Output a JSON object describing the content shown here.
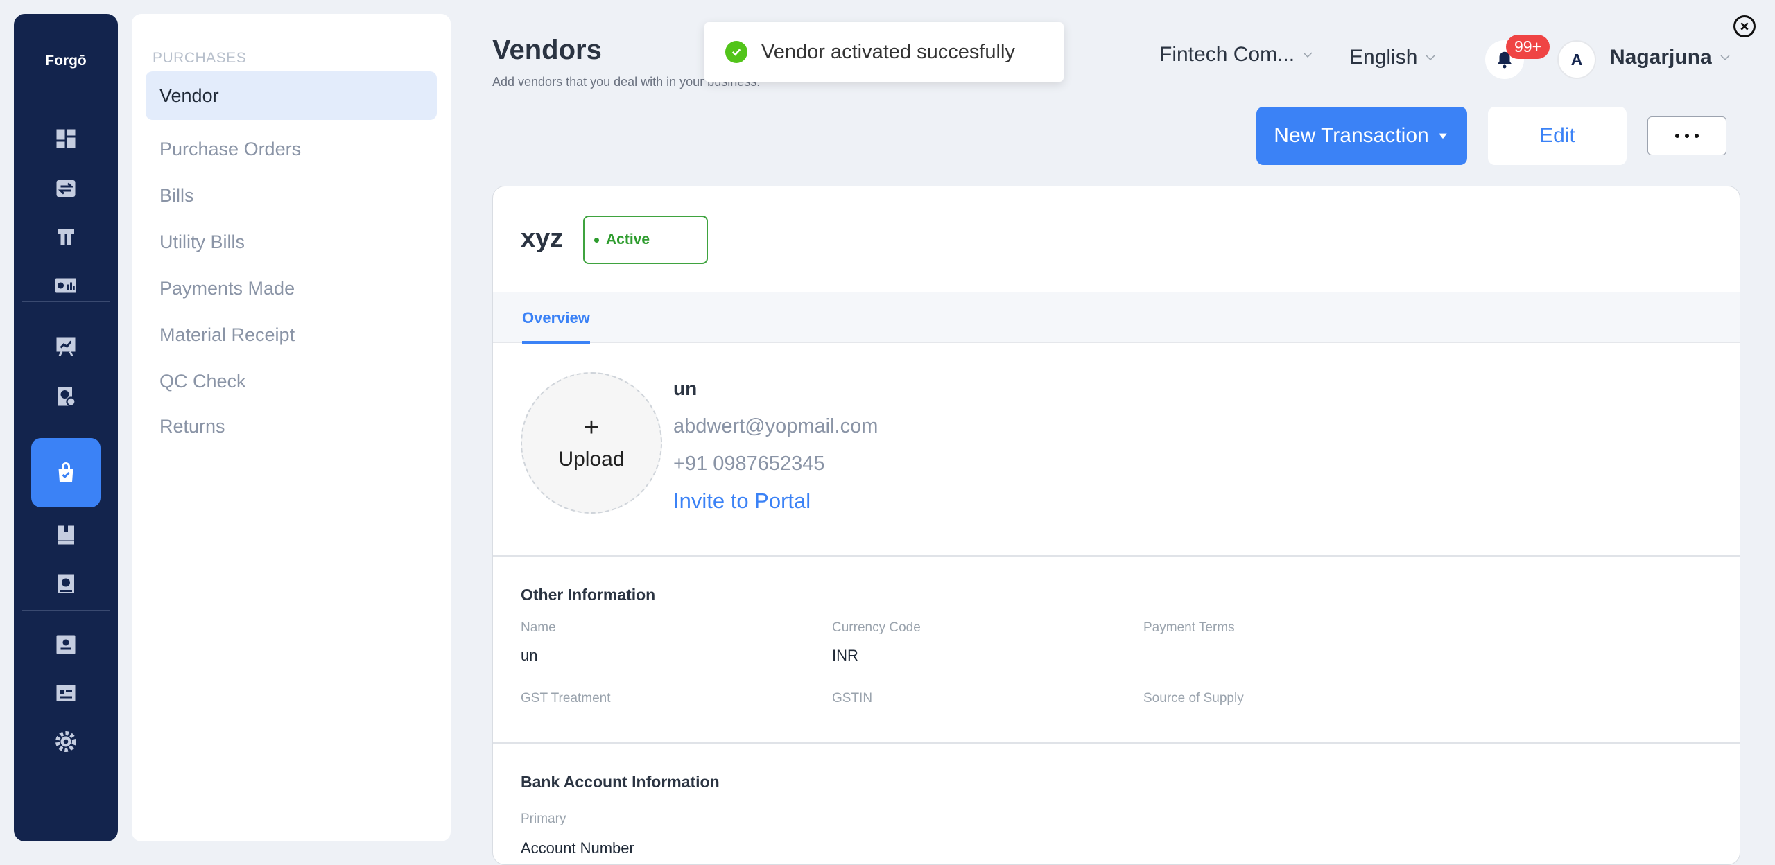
{
  "brand": {
    "logo": "Forgō"
  },
  "rail": {
    "icons": [
      "dashboard-icon",
      "transactions-icon",
      "items-icon",
      "reports-icon",
      "sales-icon",
      "analytics-icon",
      "purchases-icon",
      "inventory-icon",
      "accounting-icon",
      "contacts-icon",
      "documents-icon",
      "settings-icon"
    ],
    "active": "purchases-icon"
  },
  "subnav": {
    "heading": "PURCHASES",
    "items": [
      {
        "label": "Vendor",
        "active": true
      },
      {
        "label": "Purchase Orders",
        "active": false
      },
      {
        "label": "Bills",
        "active": false
      },
      {
        "label": "Utility Bills",
        "active": false
      },
      {
        "label": "Payments Made",
        "active": false
      },
      {
        "label": "Material Receipt",
        "active": false
      },
      {
        "label": "QC Check",
        "active": false
      },
      {
        "label": "Returns",
        "active": false
      }
    ]
  },
  "page": {
    "title": "Vendors",
    "subtitle": "Add vendors that you deal with in your business."
  },
  "toast": {
    "message": "Vendor activated succesfully"
  },
  "topbar": {
    "company": "Fintech Com...",
    "language": "English",
    "notifications_badge": "99+",
    "avatar_initial": "A",
    "user_name": "Nagarjuna"
  },
  "actions": {
    "new_transaction": "New Transaction",
    "edit": "Edit"
  },
  "vendor": {
    "name": "xyz",
    "status": "Active",
    "tab": "Overview",
    "upload_plus": "+",
    "upload_label": "Upload",
    "contact_name": "un",
    "email": "abdwert@yopmail.com",
    "phone": "+91 0987652345",
    "invite": "Invite to Portal"
  },
  "other_info": {
    "title": "Other Information",
    "fields": [
      {
        "label": "Name",
        "value": "un"
      },
      {
        "label": "Currency Code",
        "value": "INR"
      },
      {
        "label": "Payment Terms",
        "value": ""
      },
      {
        "label": "GST Treatment",
        "value": ""
      },
      {
        "label": "GSTIN",
        "value": ""
      },
      {
        "label": "Source of Supply",
        "value": ""
      }
    ]
  },
  "bank_info": {
    "title": "Bank Account Information",
    "primary_label": "Primary",
    "account_number_label": "Account Number"
  },
  "colors": {
    "accent": "#3b82f6",
    "rail": "#13244d",
    "success": "#52c41a",
    "badge": "#ef4444"
  }
}
